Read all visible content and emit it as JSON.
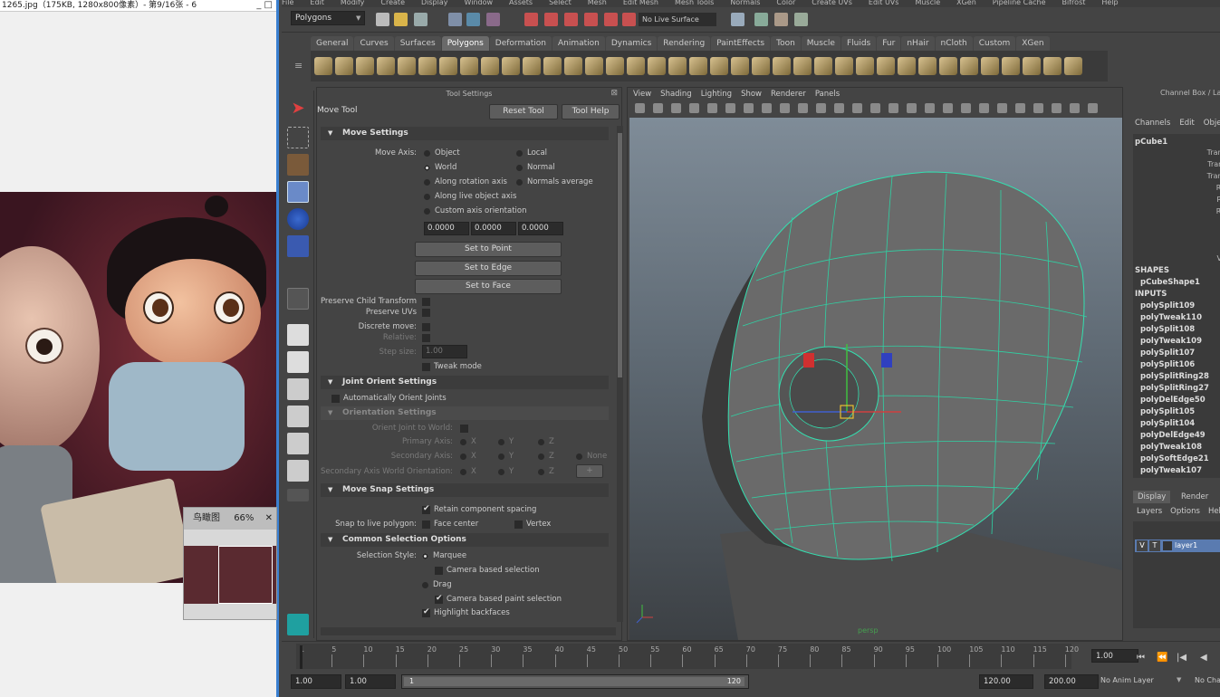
{
  "viewer": {
    "title": "1265.jpg（175KB, 1280x800像素）- 第9/16张 - 6",
    "winbtns": "_  □",
    "navigator_title": "鸟瞰图",
    "navigator_zoom": "66%",
    "navigator_close": "✕"
  },
  "maya": {
    "menus": [
      "File",
      "Edit",
      "Modify",
      "Create",
      "Display",
      "Window",
      "Assets",
      "Select",
      "Mesh",
      "Edit Mesh",
      "Mesh Tools",
      "Normals",
      "Color",
      "Create UVs",
      "Edit UVs",
      "Muscle",
      "XGen",
      "Pipeline Cache",
      "Bifrost",
      "Help"
    ],
    "mode": "Polygons",
    "live_surface": "No Live Surface",
    "shelf_tabs": [
      "General",
      "Curves",
      "Surfaces",
      "Polygons",
      "Deformation",
      "Animation",
      "Dynamics",
      "Rendering",
      "PaintEffects",
      "Toon",
      "Muscle",
      "Fluids",
      "Fur",
      "nHair",
      "nCloth",
      "Custom",
      "XGen"
    ],
    "active_shelf": "Polygons",
    "shelf_icon_cp": "CP"
  },
  "tool_settings": {
    "title": "Tool Settings",
    "tool_name": "Move Tool",
    "reset_btn": "Reset Tool",
    "help_btn": "Tool Help",
    "move_settings": "Move Settings",
    "move_axis_label": "Move Axis:",
    "axis_options": [
      "Object",
      "Local",
      "World",
      "Normal",
      "Along rotation axis",
      "Normals average",
      "Along live object axis",
      "Custom axis orientation"
    ],
    "coords": [
      "0.0000",
      "0.0000",
      "0.0000"
    ],
    "set_to_point": "Set to Point",
    "set_to_edge": "Set to Edge",
    "set_to_face": "Set to Face",
    "preserve_child": "Preserve Child Transform",
    "preserve_uvs": "Preserve UVs",
    "discrete_move": "Discrete move:",
    "relative": "Relative:",
    "step_size": "Step size:",
    "step_value": "1.00",
    "tweak_mode": "Tweak mode",
    "joint_orient": "Joint Orient Settings",
    "auto_orient": "Automatically Orient Joints",
    "orientation_settings": "Orientation Settings",
    "orient_joint_world": "Orient Joint to World:",
    "primary_axis": "Primary Axis:",
    "secondary_axis": "Secondary Axis:",
    "secondary_world": "Secondary Axis World Orientation:",
    "xyz": [
      "X",
      "Y",
      "Z"
    ],
    "none": "None",
    "plus": "+",
    "move_snap": "Move Snap Settings",
    "retain_spacing": "Retain component spacing",
    "snap_live": "Snap to live polygon:",
    "face_center": "Face center",
    "vertex": "Vertex",
    "common_sel": "Common Selection Options",
    "sel_style": "Selection Style:",
    "marquee": "Marquee",
    "camera_sel": "Camera based selection",
    "drag": "Drag",
    "camera_paint": "Camera based paint selection",
    "highlight_back": "Highlight backfaces"
  },
  "viewport": {
    "menu": [
      "View",
      "Shading",
      "Lighting",
      "Show",
      "Renderer",
      "Panels"
    ],
    "camera": "persp"
  },
  "channel_box": {
    "title": "Channel Box / Layer Editor",
    "menu": [
      "Channels",
      "Edit",
      "Object"
    ],
    "object": "pCube1",
    "attrs": [
      "Translate X",
      "Translate Y",
      "Translate Z",
      "Rotate X",
      "Rotate Y",
      "Rotate Z",
      "Scale X",
      "Scale Y",
      "Scale Z",
      "Visibility"
    ],
    "shapes": "SHAPES",
    "shape_name": "pCubeShape1",
    "inputs": "INPUTS",
    "history": [
      "polySplit109",
      "polyTweak110",
      "polySplit108",
      "polyTweak109",
      "polySplit107",
      "polySplit106",
      "polySplitRing28",
      "polySplitRing27",
      "polyDelEdge50",
      "polySplit105",
      "polySplit104",
      "polyDelEdge49",
      "polyTweak108",
      "polySoftEdge21",
      "polyTweak107"
    ],
    "tabs": [
      "Display",
      "Render"
    ],
    "layer_menu": [
      "Layers",
      "Options",
      "Help"
    ],
    "layer_v": "V",
    "layer_t": "T",
    "layer_name": "layer1"
  },
  "timeline": {
    "ticks": [
      "1",
      "5",
      "10",
      "15",
      "20",
      "25",
      "30",
      "35",
      "40",
      "45",
      "50",
      "55",
      "60",
      "65",
      "70",
      "75",
      "80",
      "85",
      "90",
      "95",
      "100",
      "105",
      "110",
      "115",
      "120"
    ],
    "current_frame": "1.00",
    "range_start": "1.00",
    "range_start2": "1.00",
    "slider_start": "1",
    "slider_end": "120",
    "range_end": "120.00",
    "range_end2": "200.00",
    "anim_layer": "No Anim Layer",
    "char": "No Character"
  }
}
